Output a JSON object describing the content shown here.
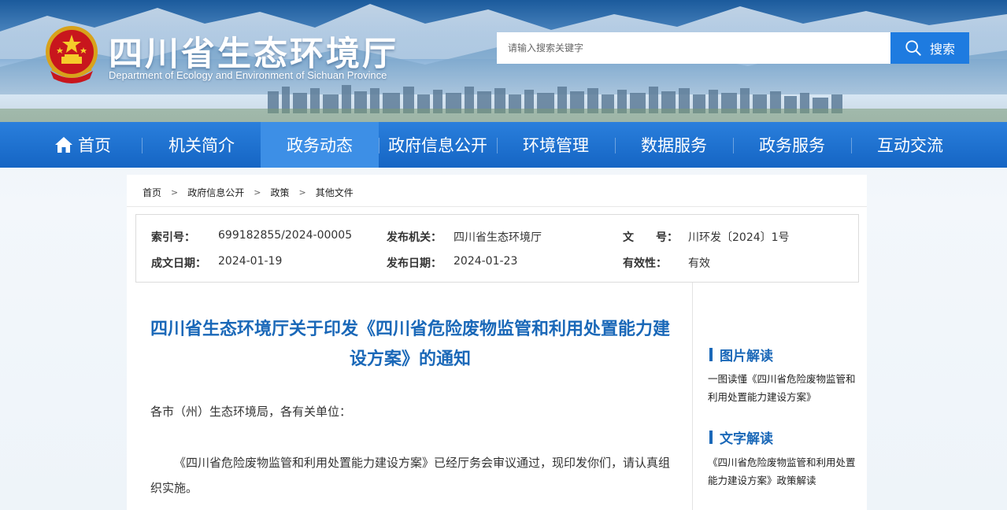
{
  "header": {
    "title": "四川省生态环境厅",
    "subtitle": "Department of Ecology and Environment of Sichuan Province",
    "search_placeholder": "请输入搜索关键字",
    "search_label": "搜索"
  },
  "nav": {
    "items": [
      {
        "label": "首页"
      },
      {
        "label": "机关简介"
      },
      {
        "label": "政务动态"
      },
      {
        "label": "政府信息公开"
      },
      {
        "label": "环境管理"
      },
      {
        "label": "数据服务"
      },
      {
        "label": "政务服务"
      },
      {
        "label": "互动交流"
      }
    ],
    "active": "政务动态"
  },
  "breadcrumb": [
    "首页",
    "政府信息公开",
    "政策",
    "其他文件"
  ],
  "meta": {
    "index_label": "索引号：",
    "index_value": "699182855/2024-00005",
    "issuer_label": "发布机关：",
    "issuer_value": "四川省生态环境厅",
    "doc_no_label": "文　　号：",
    "doc_no_value": "川环发〔2024〕1号",
    "created_label": "成文日期：",
    "created_value": "2024-01-19",
    "published_label": "发布日期：",
    "published_value": "2024-01-23",
    "validity_label": "有效性：",
    "validity_value": "有效"
  },
  "article": {
    "title": "四川省生态环境厅关于印发《四川省危险废物监管和利用处置能力建设方案》的通知",
    "salutation": "各市（州）生态环境局，各有关单位：",
    "paragraph1": "《四川省危险废物监管和利用处置能力建设方案》已经厅务会审议通过，现印发你们，请认真组织实施。"
  },
  "sidebar": {
    "picture_heading": "图片解读",
    "picture_link": "一图读懂《四川省危险废物监管和利用处置能力建设方案》",
    "text_heading": "文字解读",
    "text_link": "《四川省危险废物监管和利用处置能力建设方案》政策解读"
  },
  "colors": {
    "nav_blue": "#1565c4",
    "nav_active": "#3d8fe6",
    "title_blue": "#1a68b8",
    "search_button": "#1e7be0"
  }
}
